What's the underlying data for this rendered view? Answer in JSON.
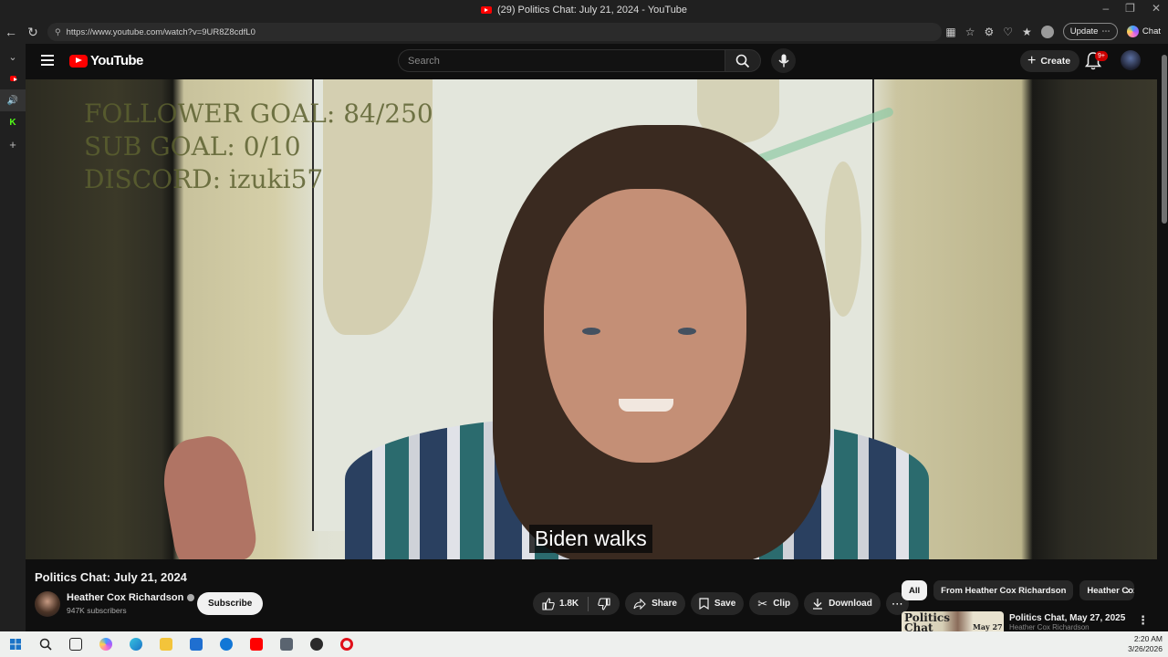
{
  "browser": {
    "tab_title": "(29) Politics Chat: July 21, 2024 - YouTube",
    "url": "https://www.youtube.com/watch?v=9UR8Z8cdfL0",
    "update_label": "Update",
    "chat_label": "Chat"
  },
  "youtube": {
    "logo_text": "YouTube",
    "search_placeholder": "Search",
    "create_label": "Create",
    "notif_badge": "9+"
  },
  "video": {
    "overlay_lines": [
      "FOLLOWER GOAL: 84/250",
      "SUB GOAL: 0/10",
      "DISCORD: izuki57"
    ],
    "caption": "Biden walks",
    "title": "Politics Chat: July 21, 2024"
  },
  "channel": {
    "name": "Heather Cox Richardson",
    "subscribers": "947K subscribers",
    "subscribe_label": "Subscribe"
  },
  "actions": {
    "likes": "1.8K",
    "share": "Share",
    "save": "Save",
    "clip": "Clip",
    "download": "Download"
  },
  "recs": {
    "chips": [
      "All",
      "From Heather Cox Richardson",
      "Heather Cox Richardson"
    ],
    "item_title": "Politics Chat, May 27, 2025",
    "item_channel": "Heather Cox Richardson",
    "thumb_text": "Politics Chat",
    "thumb_date": "May 27"
  },
  "taskbar": {
    "time": "2:20 AM",
    "date": "3/26/2026"
  },
  "colors": {
    "yt_red": "#ff0000",
    "bg": "#0f0f0f",
    "pill": "#272727"
  }
}
